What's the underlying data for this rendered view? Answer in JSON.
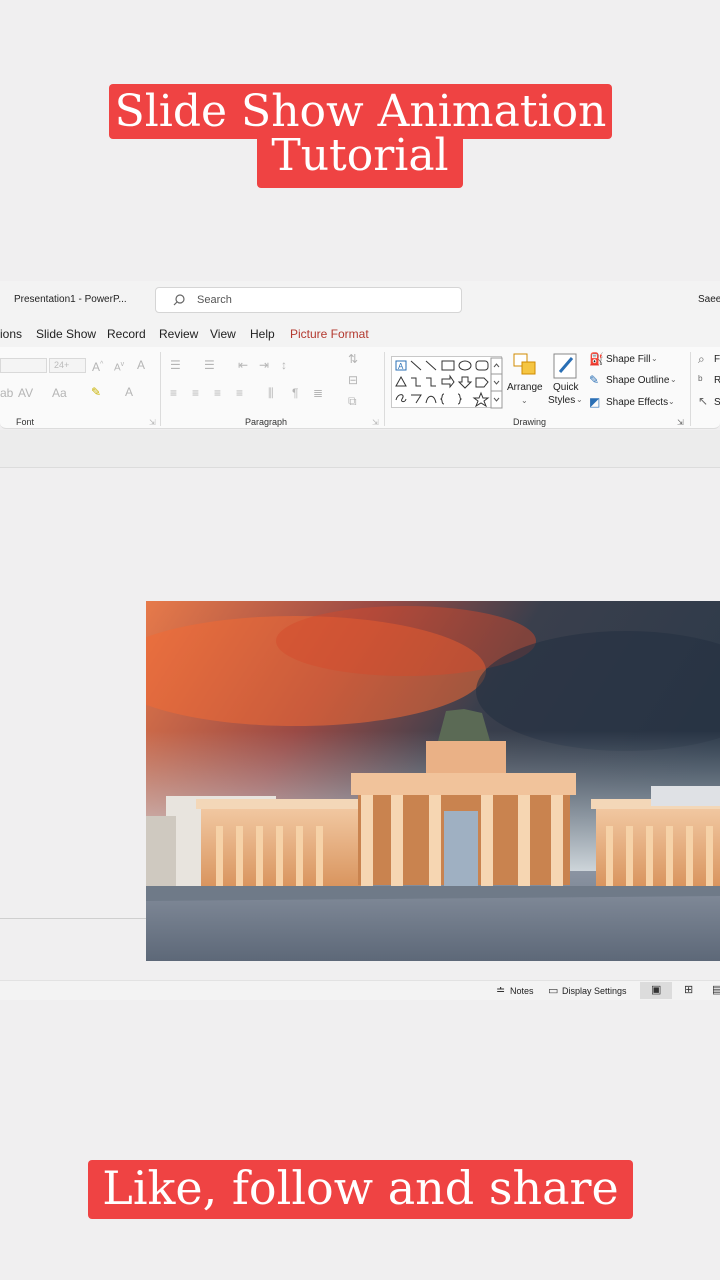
{
  "captions": {
    "title_line1": "Slide Show Animation",
    "title_line2": "Tutorial",
    "footer": "Like, follow and share"
  },
  "titlebar": {
    "document_title": "Presentation1  -  PowerP...",
    "search_placeholder": "Search",
    "user": "Saeed"
  },
  "menu": {
    "items": [
      "ions",
      "Slide Show",
      "Record",
      "Review",
      "View",
      "Help",
      "Picture Format"
    ],
    "active_accent_color": "#b3392f"
  },
  "ribbon": {
    "font_size_value": "24+",
    "groups": {
      "font": "Font",
      "paragraph": "Paragraph",
      "drawing": "Drawing"
    },
    "drawing": {
      "arrange": "Arrange",
      "quick_styles_line1": "Quick",
      "quick_styles_line2": "Styles",
      "shape_fill": "Shape Fill",
      "shape_outline": "Shape Outline",
      "shape_effects": "Shape Effects"
    },
    "editing_partial": [
      "F",
      "R",
      "S"
    ]
  },
  "statusbar": {
    "notes": "Notes",
    "display_settings": "Display Settings"
  },
  "colors": {
    "caption_red": "#ef4343",
    "ribbon_bg": "#fafafa",
    "window_bg": "#f0eff0"
  }
}
